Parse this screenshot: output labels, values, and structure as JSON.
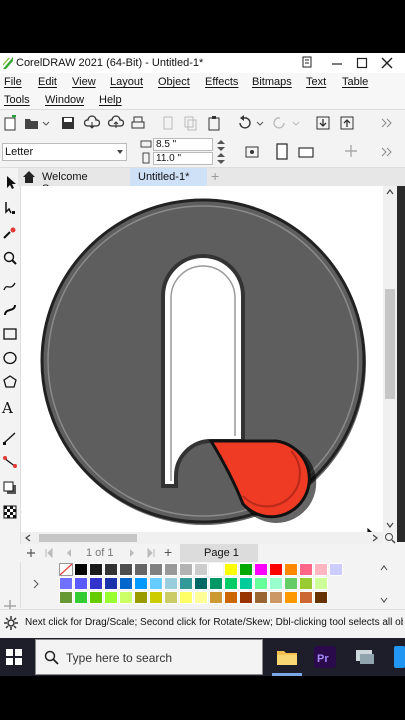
{
  "window": {
    "title": "CorelDRAW 2021 (64-Bit) - Untitled-1*"
  },
  "menu": {
    "row1": [
      "File",
      "Edit",
      "View",
      "Layout",
      "Object",
      "Effects",
      "Bitmaps",
      "Text",
      "Table"
    ],
    "row2": [
      "Tools",
      "Window",
      "Help"
    ]
  },
  "property_bar": {
    "page_size": "Letter",
    "width": "8.5 \"",
    "height": "11.0 \""
  },
  "tabs": {
    "welcome": "Welcome Screen",
    "document": "Untitled-1*",
    "add": "+"
  },
  "page_nav": {
    "page_count": "1 of 1",
    "page_tab": "Page 1",
    "add": "+"
  },
  "status": {
    "hint": "Next click for Drag/Scale; Second click for Rotate/Skew; Dbl-clicking tool selects all obj"
  },
  "taskbar": {
    "search_placeholder": "Type here to search"
  },
  "colors": {
    "accent": "#1e6bd6",
    "circle_fill": "#5e5e5e",
    "red_shape": "#ef3a24",
    "taskbar": "#1e1e2a"
  },
  "palette": {
    "row1": [
      "#000000",
      "#1a1a1a",
      "#333333",
      "#4d4d4d",
      "#666666",
      "#808080",
      "#999999",
      "#b3b3b3",
      "#cccccc",
      "#ffffff",
      "#ffff00",
      "#00aa00",
      "#ff00ff",
      "#ff0000",
      "#ff8800",
      "#ff6688",
      "#ffb6c1",
      "#ccccff"
    ],
    "row2": [
      "#7070ff",
      "#5a5aff",
      "#3333cc",
      "#1a33aa",
      "#0066cc",
      "#0099ff",
      "#66ccff",
      "#99ccdd",
      "#339999",
      "#006666",
      "#009966",
      "#00cc66",
      "#00cc99",
      "#66ff99",
      "#99ffcc",
      "#66cc66",
      "#99cc33",
      "#ccff99"
    ],
    "row3": [
      "#669933",
      "#33cc33",
      "#66cc00",
      "#99ff33",
      "#ccff66",
      "#999900",
      "#cccc00",
      "#cccc66",
      "#ffff66",
      "#ffff99",
      "#cc9933",
      "#cc6600",
      "#993300",
      "#996633",
      "#cc9966",
      "#ff9900",
      "#cc6633",
      "#663300"
    ]
  }
}
